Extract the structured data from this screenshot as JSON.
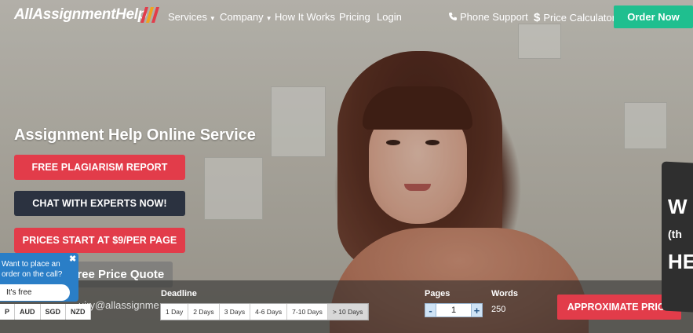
{
  "header": {
    "logo_text": "AllAssignmentHelp",
    "nav": [
      {
        "label": "Services",
        "has_caret": true
      },
      {
        "label": "Company",
        "has_caret": true
      },
      {
        "label": "How It Works",
        "has_caret": false
      },
      {
        "label": "Pricing",
        "has_caret": false
      },
      {
        "label": "Login",
        "has_caret": false
      }
    ],
    "phone_support": "Phone Support",
    "price_calculator": "Price Calculator",
    "order_now": "Order Now"
  },
  "hero": {
    "headline": "Assignment Help Online Service",
    "cta_plagiarism": "FREE PLAGIARISM REPORT",
    "cta_chat": "CHAT WITH EXPERTS NOW!",
    "cta_prices": "PRICES START AT $9/PER PAGE",
    "quote_tab": "Get Free Price Quote"
  },
  "calculator": {
    "email_partial": "uiry@allassignme",
    "currencies": [
      "P",
      "AUD",
      "SGD",
      "NZD"
    ],
    "deadline_label": "Deadline",
    "deadline_options": [
      "1 Day",
      "2 Days",
      "3 Days",
      "4-6 Days",
      "7-10 Days",
      "> 10 Days"
    ],
    "deadline_selected": "> 10 Days",
    "pages_label": "Pages",
    "pages_value": "1",
    "minus": "-",
    "plus": "+",
    "words_label": "Words",
    "words_value": "250",
    "approximate_price": "APPROXIMATE PRICE"
  },
  "chat_popup": {
    "line1": "Want to place an",
    "line2": "order on the call?",
    "close": "✖",
    "button": "It's free"
  },
  "badge": {
    "letters": [
      "W",
      "(th",
      "HE"
    ]
  },
  "colors": {
    "accent_red": "#e23c4a",
    "order_green": "#1fbf8f",
    "dark_button": "#2b3240",
    "chat_blue": "#2a7ec7"
  }
}
